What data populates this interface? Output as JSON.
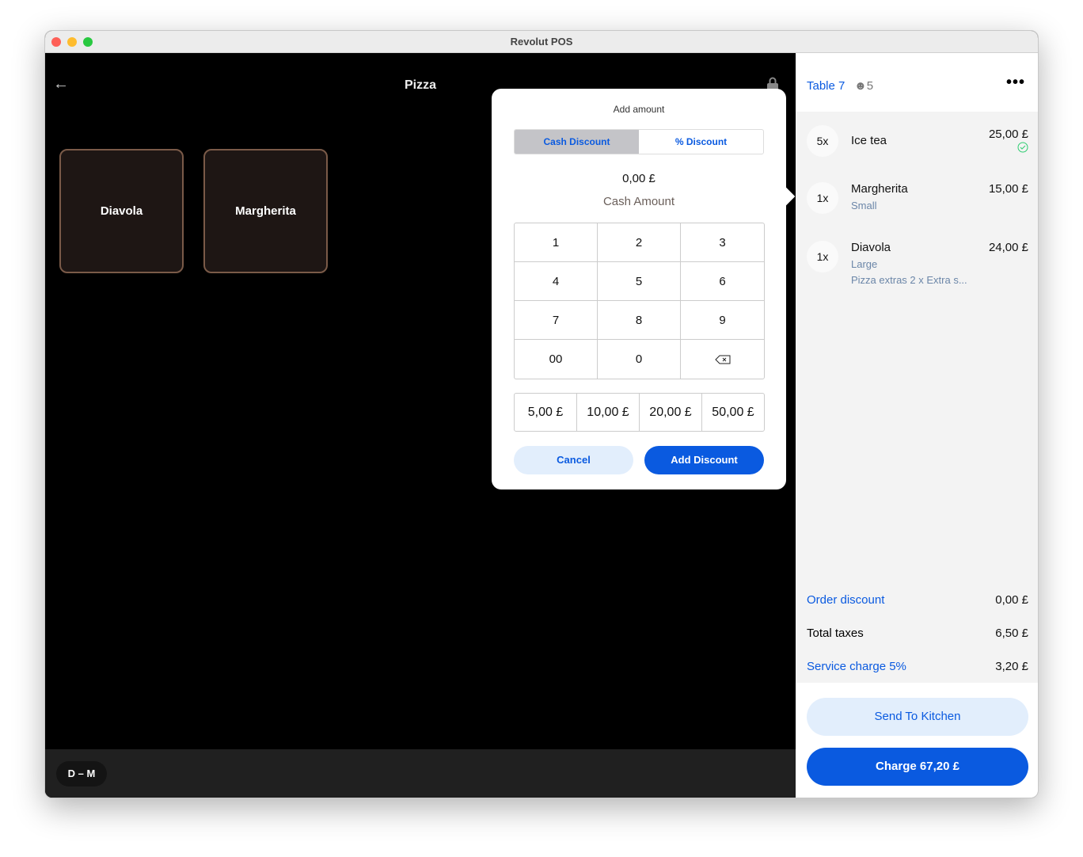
{
  "window": {
    "title": "Revolut POS"
  },
  "menu": {
    "title": "Pizza",
    "products": [
      "Diavola",
      "Margherita"
    ],
    "user_badge": "D – M"
  },
  "order": {
    "table": "Table 7",
    "guests": "5",
    "items": [
      {
        "qty": "5x",
        "name": "Ice tea",
        "price": "25,00 £",
        "sent": true
      },
      {
        "qty": "1x",
        "name": "Margherita",
        "price": "15,00 £",
        "details": [
          "Small"
        ]
      },
      {
        "qty": "1x",
        "name": "Diavola",
        "price": "24,00 £",
        "details": [
          "Large",
          "Pizza extras 2 x Extra s..."
        ]
      }
    ],
    "summary": {
      "order_discount_label": "Order discount",
      "order_discount": "0,00 £",
      "taxes_label": "Total taxes",
      "taxes": "6,50 £",
      "service_label": "Service charge 5%",
      "service": "3,20 £"
    },
    "send_label": "Send To Kitchen",
    "charge_label": "Charge 67,20 £"
  },
  "dialog": {
    "title": "Add amount",
    "tabs": [
      "Cash Discount",
      "% Discount"
    ],
    "active_tab": "Cash Discount",
    "amount": "0,00 £",
    "amount_label": "Cash Amount",
    "keys": [
      "1",
      "2",
      "3",
      "4",
      "5",
      "6",
      "7",
      "8",
      "9",
      "00",
      "0"
    ],
    "quick_amounts": [
      "5,00 £",
      "10,00 £",
      "20,00 £",
      "50,00 £"
    ],
    "cancel_label": "Cancel",
    "confirm_label": "Add Discount"
  },
  "colors": {
    "accent": "#0a5ae0",
    "accent_light": "#e2eefc",
    "success": "#2ecc71"
  }
}
